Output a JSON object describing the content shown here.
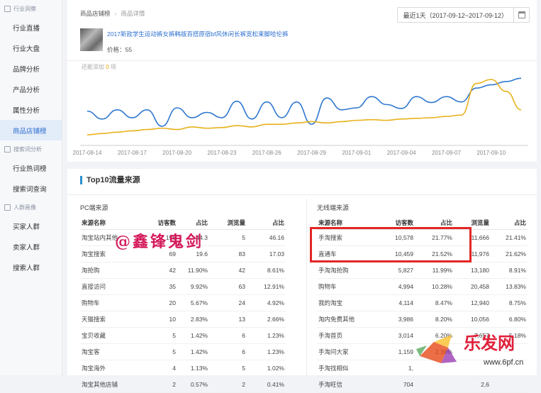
{
  "sidebar": {
    "groups": [
      {
        "label": "行业洞察",
        "items": [
          "行业直播",
          "行业大盘",
          "品牌分析",
          "产品分析",
          "属性分析",
          "商品店铺榜"
        ]
      },
      {
        "label": "搜索词分析",
        "items": [
          "行业热词榜",
          "搜索词查询"
        ]
      },
      {
        "label": "人群画像",
        "items": [
          "买家人群",
          "卖家人群",
          "搜索人群"
        ]
      }
    ],
    "active": "商品店铺榜"
  },
  "breadcrumb": {
    "root": "商品店铺榜",
    "sep": "›",
    "current": "商品详情"
  },
  "date_range": "最近1天（2017-09-12~2017-09-12）",
  "product": {
    "title": "2017新款学生运动裤女裤韩版百搭原宿bf风休闲长裤宽松束脚哈伦裤",
    "price": "价格：55"
  },
  "chart_hint": {
    "text": "还能添加",
    "num": "0",
    "unit": "项"
  },
  "chart_data": {
    "type": "line",
    "x": [
      "2017-08-14",
      "2017-08-15",
      "2017-08-16",
      "2017-08-17",
      "2017-08-18",
      "2017-08-19",
      "2017-08-20",
      "2017-08-21",
      "2017-08-22",
      "2017-08-23",
      "2017-08-24",
      "2017-08-25",
      "2017-08-26",
      "2017-08-27",
      "2017-08-28",
      "2017-08-29",
      "2017-08-30",
      "2017-08-31",
      "2017-09-01",
      "2017-09-02",
      "2017-09-03",
      "2017-09-04",
      "2017-09-05",
      "2017-09-06",
      "2017-09-07",
      "2017-09-08",
      "2017-09-09",
      "2017-09-10",
      "2017-09-11",
      "2017-09-12"
    ],
    "xticks": [
      "2017-08-14",
      "2017-08-17",
      "2017-08-20",
      "2017-08-23",
      "2017-08-26",
      "2017-08-29",
      "2017-09-01",
      "2017-09-04",
      "2017-09-07",
      "2017-09-10"
    ],
    "series": [
      {
        "color": "#2f78d0",
        "values": [
          50,
          38,
          52,
          40,
          52,
          27,
          55,
          40,
          48,
          40,
          65,
          38,
          64,
          40,
          64,
          30,
          70,
          52,
          55,
          72,
          60,
          54,
          72,
          63,
          72,
          64,
          85,
          90,
          95,
          100
        ]
      },
      {
        "color": "#e8b21e",
        "values": [
          14,
          16,
          18,
          20,
          22,
          24,
          22,
          26,
          24,
          25,
          28,
          26,
          30,
          30,
          32,
          34,
          32,
          34,
          36,
          37,
          36,
          38,
          39,
          40,
          42,
          44,
          92,
          98,
          80,
          52
        ]
      }
    ],
    "ylim": [
      0,
      110
    ],
    "grid": false
  },
  "section_title": "Top10流量来源",
  "pc_table": {
    "title": "PC端来源",
    "headers": [
      "来源名称",
      "访客数",
      "占比",
      "浏览量",
      "占比"
    ],
    "rows": [
      [
        "淘宝站内其他",
        "156",
        "44.3",
        "5",
        "46.16"
      ],
      [
        "淘宝搜索",
        "69",
        "19.6",
        "83",
        "17.03"
      ],
      [
        "淘抢购",
        "42",
        "11.90%",
        "42",
        "8.61%"
      ],
      [
        "直接访问",
        "35",
        "9.92%",
        "63",
        "12.91%"
      ],
      [
        "购物车",
        "20",
        "5.67%",
        "24",
        "4.92%"
      ],
      [
        "天猫搜索",
        "10",
        "2.83%",
        "13",
        "2.66%"
      ],
      [
        "宝贝收藏",
        "5",
        "1.42%",
        "6",
        "1.23%"
      ],
      [
        "淘宝客",
        "5",
        "1.42%",
        "6",
        "1.23%"
      ],
      [
        "淘宝海外",
        "4",
        "1.13%",
        "5",
        "1.02%"
      ],
      [
        "淘宝其他店铺",
        "2",
        "0.57%",
        "2",
        "0.41%"
      ]
    ]
  },
  "mobile_table": {
    "title": "无线端来源",
    "headers": [
      "来源名称",
      "访客数",
      "占比",
      "浏览量",
      "占比"
    ],
    "rows": [
      [
        "手淘搜索",
        "10,578",
        "21.77%",
        "11,666",
        "21.41%"
      ],
      [
        "直通车",
        "10,459",
        "21.52%",
        "11,976",
        "21.62%"
      ],
      [
        "手淘淘抢购",
        "5,827",
        "11.99%",
        "13,180",
        "8.91%"
      ],
      [
        "购物车",
        "4,994",
        "10.28%",
        "20,458",
        "13.83%"
      ],
      [
        "我的淘宝",
        "4,114",
        "8.47%",
        "12,940",
        "8.75%"
      ],
      [
        "淘内免费其他",
        "3,986",
        "8.20%",
        "10,056",
        "6.80%"
      ],
      [
        "手淘首页",
        "3,014",
        "6.20%",
        "7,657",
        "5.18%"
      ],
      [
        "手淘问大家",
        "1,159",
        "2.38%",
        "",
        ""
      ],
      [
        "手淘找相似",
        "1,",
        "",
        "",
        ""
      ],
      [
        "手淘旺信",
        "704",
        "",
        "2,6",
        ""
      ]
    ]
  },
  "watermark": "@鑫锋鬼剑",
  "brand": {
    "name": "乐发网",
    "url": "www.6pf.cn"
  }
}
